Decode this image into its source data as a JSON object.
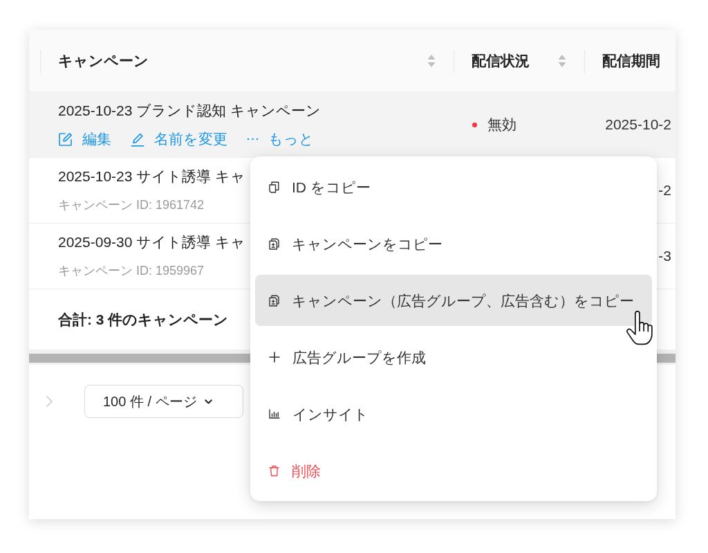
{
  "table": {
    "columns": [
      {
        "label": "キャンペーン",
        "sortable": true
      },
      {
        "label": "配信状況",
        "sortable": true
      },
      {
        "label": "配信期間",
        "sortable": false
      }
    ],
    "rows": [
      {
        "name": "2025-10-23 ブランド認知 キャンペーン",
        "hovered": true,
        "actions": [
          {
            "kind": "edit",
            "label": "編集"
          },
          {
            "kind": "rename",
            "label": "名前を変更"
          },
          {
            "kind": "more",
            "label": "もっと"
          }
        ],
        "status": {
          "label": "無効",
          "color": "#f5363d"
        },
        "period": "2025-10-2"
      },
      {
        "name": "2025-10-23 サイト誘導 キャ",
        "hovered": false,
        "id_text": "キャンペーン ID: 1961742",
        "period": "-2"
      },
      {
        "name": "2025-09-30 サイト誘導 キャ",
        "hovered": false,
        "id_text": "キャンペーン ID: 1959967",
        "period": "-3"
      }
    ],
    "summary": "合計: 3 件のキャンペーン"
  },
  "pagination": {
    "next_disabled": true,
    "page_size": "100 件 / ページ"
  },
  "context_menu": {
    "items": [
      {
        "kind": "copy",
        "label": "ID をコピー",
        "hovered": false
      },
      {
        "kind": "duplicate",
        "label": "キャンペーンをコピー",
        "hovered": false
      },
      {
        "kind": "duplicate",
        "label": "キャンペーン（広告グループ、広告含む）をコピー",
        "hovered": true
      },
      {
        "kind": "create",
        "label": "広告グループを作成",
        "hovered": false
      },
      {
        "kind": "insight",
        "label": "インサイト",
        "hovered": false
      },
      {
        "kind": "delete",
        "label": "削除",
        "hovered": false
      }
    ]
  },
  "pointer": {
    "kind": "hand"
  }
}
